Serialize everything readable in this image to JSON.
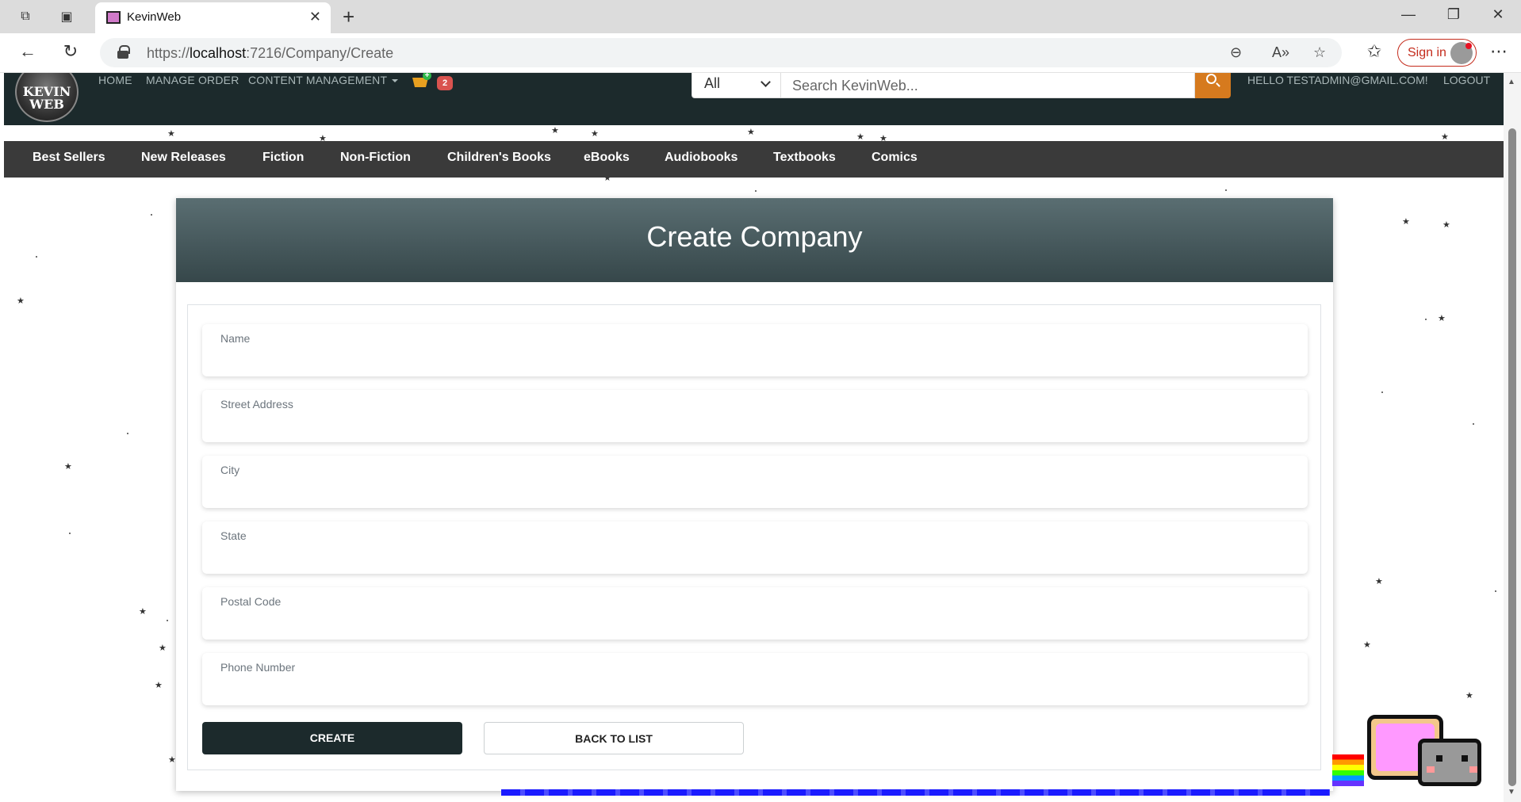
{
  "browser": {
    "tab_title": "KevinWeb",
    "url_prefix": "https://",
    "url_host": "localhost",
    "url_rest": ":7216/Company/Create",
    "signin_label": "Sign in"
  },
  "header": {
    "logo_text": "KEVIN WEB",
    "nav": {
      "home": "HOME",
      "manage_order": "MANAGE ORDER",
      "content_management": "CONTENT MANAGEMENT"
    },
    "cart_count": "2",
    "search": {
      "category": "All",
      "placeholder": "Search KevinWeb..."
    },
    "greeting": "HELLO TESTADMIN@GMAIL.COM!",
    "logout": "LOGOUT"
  },
  "categories": [
    "Best Sellers",
    "New Releases",
    "Fiction",
    "Non-Fiction",
    "Children's Books",
    "eBooks",
    "Audiobooks",
    "Textbooks",
    "Comics"
  ],
  "form": {
    "title": "Create Company",
    "fields": [
      {
        "label": "Name",
        "value": ""
      },
      {
        "label": "Street Address",
        "value": ""
      },
      {
        "label": "City",
        "value": ""
      },
      {
        "label": "State",
        "value": ""
      },
      {
        "label": "Postal Code",
        "value": ""
      },
      {
        "label": "Phone Number",
        "value": ""
      }
    ],
    "create_label": "CREATE",
    "back_label": "BACK TO LIST"
  },
  "colors": {
    "topnav_bg": "#1c2a2c",
    "catbar_bg": "#3a3a3a",
    "search_btn": "#d67a1e",
    "create_btn": "#1c2a2c",
    "cart_badge": "#d9534f"
  }
}
